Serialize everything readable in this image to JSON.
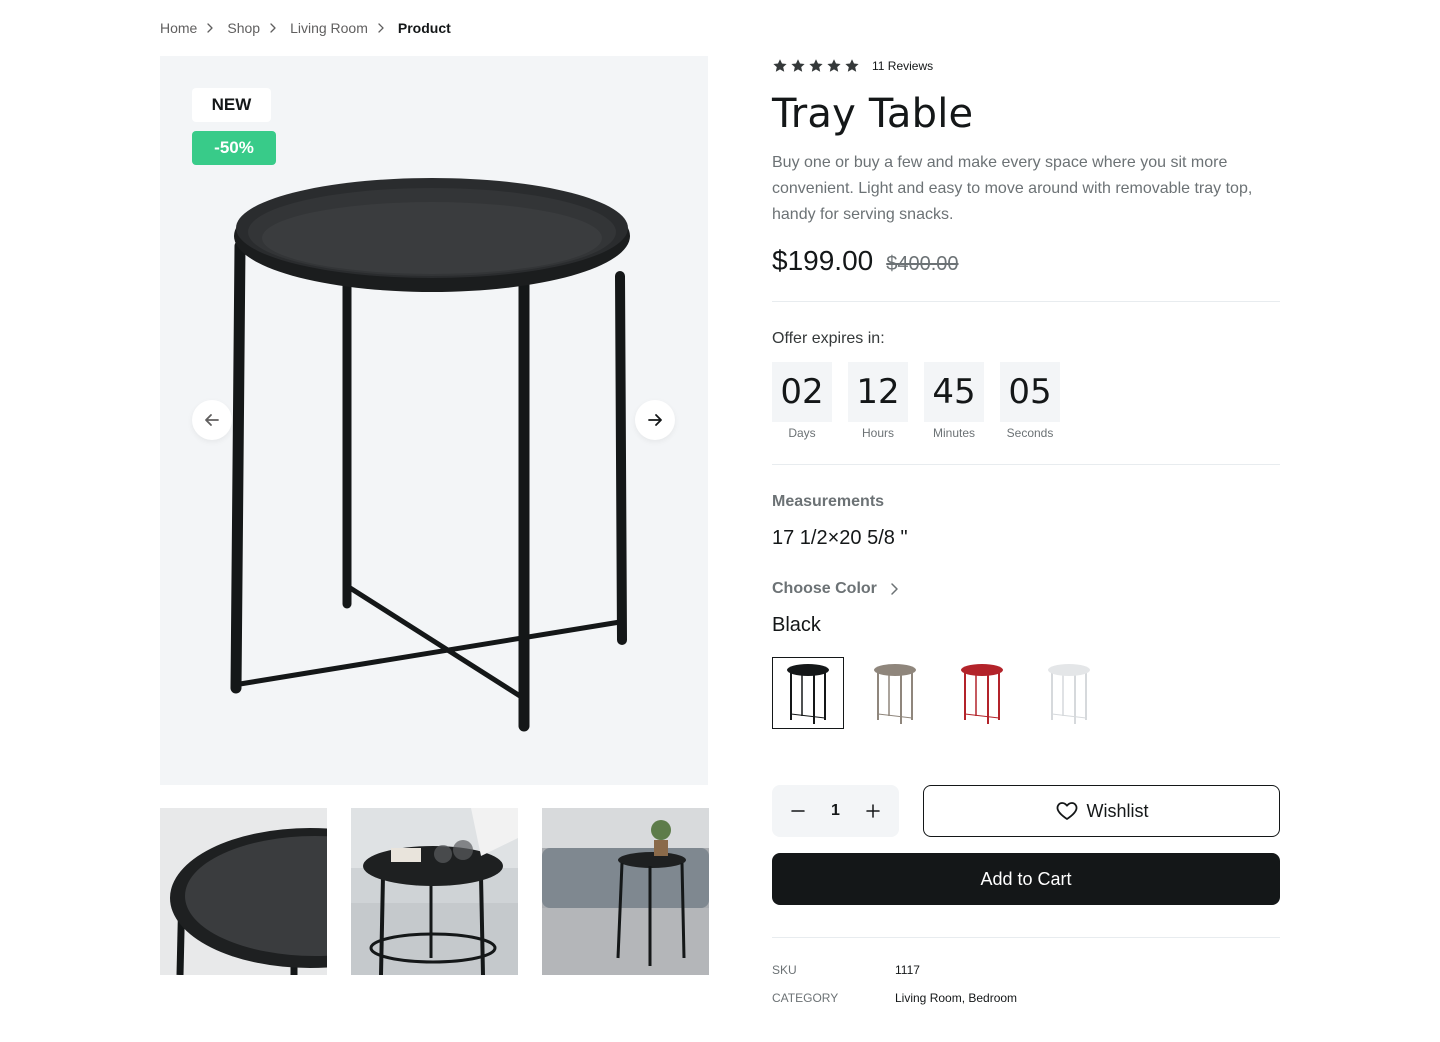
{
  "breadcrumb": [
    {
      "label": "Home"
    },
    {
      "label": "Shop"
    },
    {
      "label": "Living Room"
    },
    {
      "label": "Product"
    }
  ],
  "gallery": {
    "badge_new": "NEW",
    "badge_discount": "-50%",
    "thumbnails_count": 3
  },
  "product": {
    "rating_stars": 5,
    "reviews": "11 Reviews",
    "title": "Tray Table",
    "description": "Buy one or buy a few and make every space where you sit more convenient. Light and easy to move around with removable tray top, handy for serving snacks.",
    "price": "$199.00",
    "old_price": "$400.00"
  },
  "offer": {
    "label": "Offer expires in:",
    "units": [
      {
        "value": "02",
        "label": "Days"
      },
      {
        "value": "12",
        "label": "Hours"
      },
      {
        "value": "45",
        "label": "Minutes"
      },
      {
        "value": "05",
        "label": "Seconds"
      }
    ]
  },
  "measurements": {
    "label": "Measurements",
    "value": "17 1/2×20 5/8 \""
  },
  "color": {
    "label": "Choose Color",
    "selected": "Black",
    "swatches": [
      {
        "name": "black",
        "color": "#141718",
        "selected": true
      },
      {
        "name": "beige",
        "color": "#8f867c",
        "selected": false
      },
      {
        "name": "red",
        "color": "#b3232a",
        "selected": false
      },
      {
        "name": "white",
        "color": "#e4e6e8",
        "selected": false
      }
    ]
  },
  "actions": {
    "quantity": "1",
    "wishlist_label": "Wishlist",
    "add_to_cart_label": "Add to Cart"
  },
  "meta": [
    {
      "key": "SKU",
      "value": "1117"
    },
    {
      "key": "CATEGORY",
      "value": "Living Room, Bedroom"
    }
  ],
  "colors": {
    "text_primary": "#141718",
    "text_secondary": "#6c7275",
    "discount_green": "#38cb89",
    "image_bg": "#f3f5f7"
  }
}
